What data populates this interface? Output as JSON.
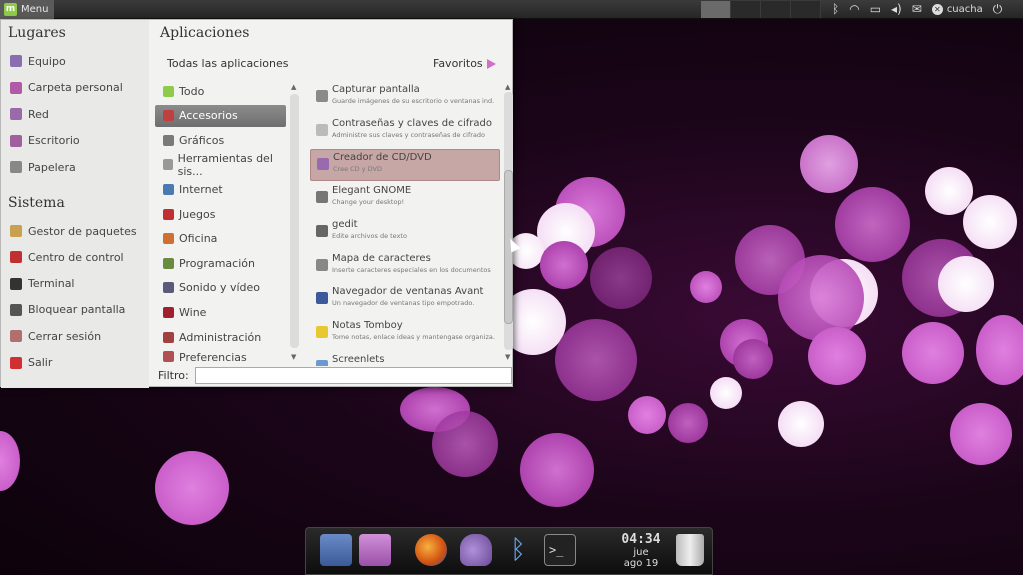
{
  "top_panel": {
    "menu_label": "Menu",
    "logo_letter": "m",
    "user_name": "cuacha",
    "tray_icons": [
      "bluetooth-icon",
      "wifi-icon",
      "battery-icon",
      "volume-icon",
      "mail-icon",
      "user-icon",
      "power-icon"
    ]
  },
  "menu": {
    "places_title": "Lugares",
    "places": [
      {
        "label": "Equipo",
        "icon": "computer-icon",
        "color": "#8a6fb0"
      },
      {
        "label": "Carpeta personal",
        "icon": "home-folder-icon",
        "color": "#b05aa8"
      },
      {
        "label": "Red",
        "icon": "network-icon",
        "color": "#9a6aa8"
      },
      {
        "label": "Escritorio",
        "icon": "desktop-icon",
        "color": "#a060a0"
      },
      {
        "label": "Papelera",
        "icon": "trash-icon",
        "color": "#888888"
      }
    ],
    "system_title": "Sistema",
    "system": [
      {
        "label": "Gestor de paquetes",
        "icon": "package-icon",
        "color": "#c8a050"
      },
      {
        "label": "Centro de control",
        "icon": "tools-icon",
        "color": "#c03030"
      },
      {
        "label": "Terminal",
        "icon": "terminal-icon",
        "color": "#333333"
      },
      {
        "label": "Bloquear pantalla",
        "icon": "lock-screen-icon",
        "color": "#555555"
      },
      {
        "label": "Cerrar sesión",
        "icon": "logout-icon",
        "color": "#b07070"
      },
      {
        "label": "Salir",
        "icon": "quit-icon",
        "color": "#d03030"
      }
    ],
    "apps_title": "Aplicaciones",
    "all_apps_label": "Todas las aplicaciones",
    "favorites_label": "Favoritos",
    "categories": [
      {
        "label": "Todo",
        "icon": "all-icon",
        "color": "#8fcb4a"
      },
      {
        "label": "Accesorios",
        "icon": "accessories-icon",
        "color": "#c04040",
        "selected": true
      },
      {
        "label": "Gráficos",
        "icon": "graphics-icon",
        "color": "#7a7a7a"
      },
      {
        "label": "Herramientas del sis...",
        "icon": "system-tools-icon",
        "color": "#999999"
      },
      {
        "label": "Internet",
        "icon": "internet-icon",
        "color": "#4a7ab0"
      },
      {
        "label": "Juegos",
        "icon": "games-icon",
        "color": "#c03030"
      },
      {
        "label": "Oficina",
        "icon": "office-icon",
        "color": "#d07030"
      },
      {
        "label": "Programación",
        "icon": "programming-icon",
        "color": "#6a8a40"
      },
      {
        "label": "Sonido y vídeo",
        "icon": "multimedia-icon",
        "color": "#5a5a7a"
      },
      {
        "label": "Wine",
        "icon": "wine-icon",
        "color": "#a02030"
      },
      {
        "label": "Administración",
        "icon": "administration-icon",
        "color": "#a04040"
      },
      {
        "label": "Preferencias",
        "icon": "preferences-icon",
        "color": "#b05050"
      }
    ],
    "apps": [
      {
        "name": "Capturar pantalla",
        "desc": "Guarde imágenes de su escritorio o ventanas ind.",
        "icon": "screenshot-icon",
        "color": "#8a8a8a"
      },
      {
        "name": "Contraseñas y claves de cifrado",
        "desc": "Administre sus claves y contraseñas de cifrado",
        "icon": "keys-icon",
        "color": "#bbbbbb"
      },
      {
        "name": "Creador de CD/DVD",
        "desc": "Cree CD y DVD",
        "icon": "disc-burner-icon",
        "color": "#9a6ab0",
        "highlight": true
      },
      {
        "name": "Elegant GNOME",
        "desc": "Change your desktop!",
        "icon": "elegant-gnome-icon",
        "color": "#777777"
      },
      {
        "name": "gedit",
        "desc": "Edite archivos de texto",
        "icon": "text-editor-icon",
        "color": "#666666"
      },
      {
        "name": "Mapa de caracteres",
        "desc": "Inserte caracteres especiales en los documentos",
        "icon": "charmap-icon",
        "color": "#888888"
      },
      {
        "name": "Navegador de ventanas Avant",
        "desc": "Un navegador de ventanas tipo empotrado.",
        "icon": "avant-icon",
        "color": "#3a5a9a"
      },
      {
        "name": "Notas Tomboy",
        "desc": "Tome notas, enlace ideas y mantengase organiza.",
        "icon": "tomboy-icon",
        "color": "#e8c830"
      },
      {
        "name": "Screenlets",
        "desc": "",
        "icon": "screenlets-icon",
        "color": "#6a9ad0"
      }
    ],
    "filter_label": "Filtro:",
    "filter_value": ""
  },
  "dock": {
    "time": "04:34",
    "day": "jue",
    "date": "ago 19",
    "icons": [
      {
        "name": "photo-manager-icon",
        "color": "#5a7ab8"
      },
      {
        "name": "file-manager-icon",
        "color": "#b070c0"
      },
      {
        "name": "firefox-icon",
        "color": "#e07020"
      },
      {
        "name": "pidgin-icon",
        "color": "#8a6ab0"
      },
      {
        "name": "bluetooth-icon",
        "color": "#4a8ad0"
      },
      {
        "name": "terminal-icon",
        "color": "#333333"
      },
      {
        "name": "trash-icon",
        "color": "#aaaaaa"
      }
    ]
  }
}
